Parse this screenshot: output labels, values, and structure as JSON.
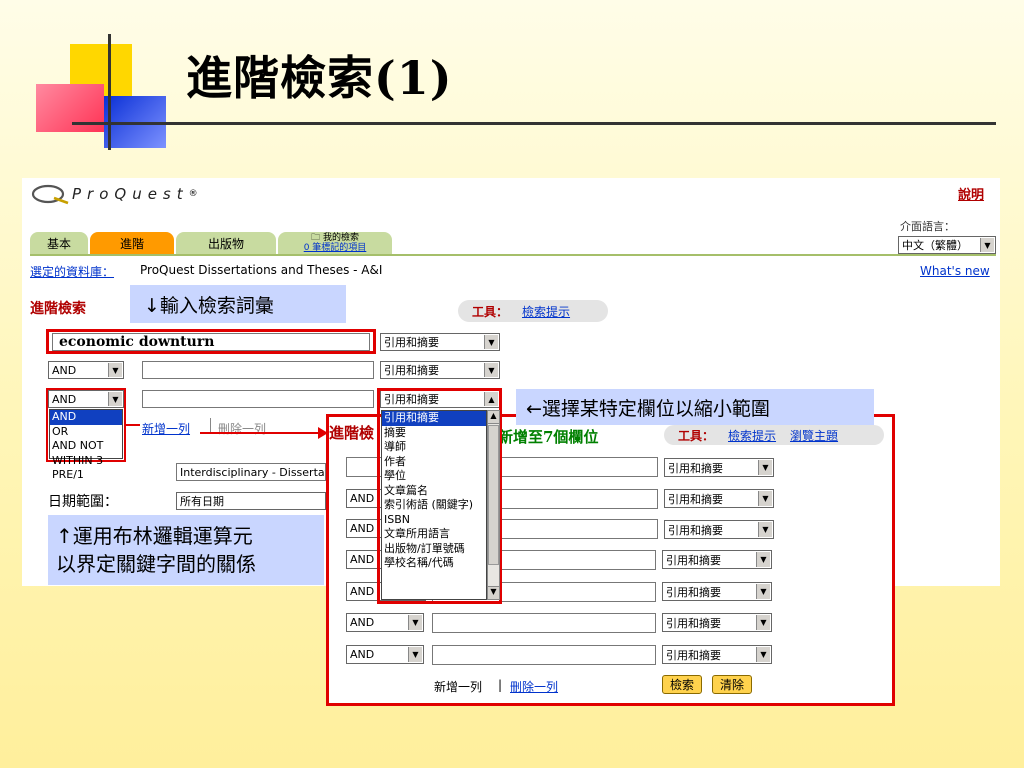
{
  "slide": {
    "title": "進階檢索(1)"
  },
  "proquest": {
    "logo_text": "ProQuest",
    "logo_mark": "®",
    "help": "說明",
    "tabs": {
      "basic": "基本",
      "advanced": "進階",
      "publications": "出版物",
      "my_search": "我的檢索",
      "my_search_sub": "0 筆標記的項目"
    },
    "language": {
      "label": "介面語言：",
      "selected": "中文（繁體）"
    },
    "database": {
      "label": "選定的資料庫：",
      "name": "ProQuest Dissertations and Theses - A&I"
    },
    "whats_new": "What's new",
    "advanced_search_title": "進階檢索",
    "tools": {
      "label": "工具：",
      "search_tips": "檢索提示",
      "browse_topics": "瀏覽主題"
    },
    "rows": [
      {
        "operator": "",
        "term": "economic downturn",
        "field": "引用和摘要"
      },
      {
        "operator": "AND",
        "term": "",
        "field": "引用和摘要"
      },
      {
        "operator": "AND",
        "term": "",
        "field": "引用和摘要"
      }
    ],
    "operator_options": [
      "AND",
      "OR",
      "AND NOT",
      "WITHIN 3",
      "PRE/1"
    ],
    "field_options": [
      "引用和摘要",
      "摘要",
      "導師",
      "作者",
      "學位",
      "文章篇名",
      "索引術語 (關鍵字)",
      "ISBN",
      "文章所用語言",
      "出版物/訂單號碼",
      "學校名稱/代碼"
    ],
    "add_row": "新增一列",
    "delete_row": "刪除一列",
    "subject_value": "Interdisciplinary - Dissertations",
    "date_label": "日期範圍：",
    "date_value": "所有日期"
  },
  "callouts": {
    "enter_terms": "↓輸入檢索詞彙",
    "select_field": "←選擇某特定欄位以縮小範圍",
    "boolean_1": "↑運用布林邏輯運算元",
    "boolean_2": "以界定關鍵字間的關係",
    "expand_prefix": "進階檢",
    "expand_suffix": "新增至7個欄位"
  },
  "expanded": {
    "rows": [
      {
        "operator": "",
        "field": "引用和摘要"
      },
      {
        "operator": "AND",
        "field": "引用和摘要"
      },
      {
        "operator": "AND",
        "field": "引用和摘要"
      },
      {
        "operator": "AND",
        "field": "引用和摘要"
      },
      {
        "operator": "AND",
        "field": "引用和摘要"
      },
      {
        "operator": "AND",
        "field": "引用和摘要"
      },
      {
        "operator": "AND",
        "field": "引用和摘要"
      }
    ],
    "add_row": "新增一列",
    "separator": "|",
    "delete_row": "刪除一列",
    "search_button": "檢索",
    "clear_button": "清除"
  },
  "colors": {
    "accent_red": "#e00000",
    "tab_active": "#ff9a00",
    "tab_inactive": "#c8dba0",
    "callout_bg": "#c9d6ff",
    "link_blue": "#0033cc"
  }
}
